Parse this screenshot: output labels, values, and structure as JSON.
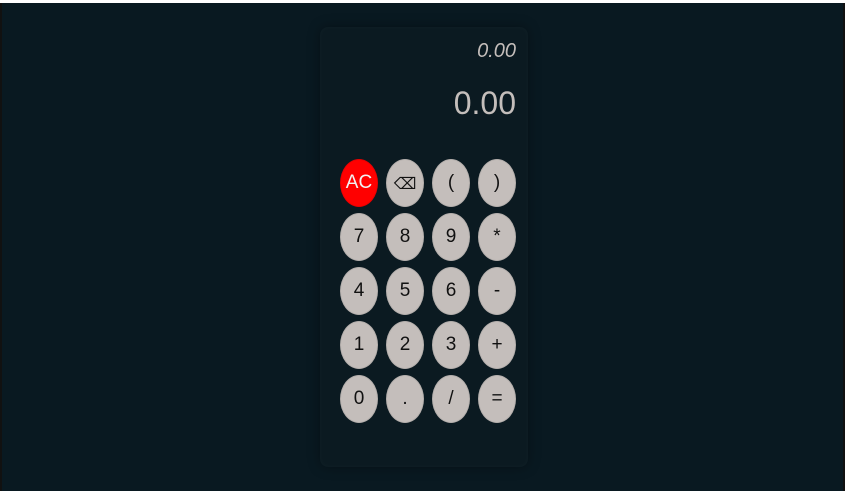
{
  "display": {
    "previous": "0.00",
    "current": "0.00"
  },
  "keys": {
    "ac": "AC",
    "backspace": "⌫",
    "paren_open": "(",
    "paren_close": ")",
    "seven": "7",
    "eight": "8",
    "nine": "9",
    "multiply": "*",
    "four": "4",
    "five": "5",
    "six": "6",
    "subtract": "-",
    "one": "1",
    "two": "2",
    "three": "3",
    "add": "+",
    "zero": "0",
    "decimal": ".",
    "divide": "/",
    "equals": "="
  },
  "colors": {
    "page_background": "#091921",
    "calculator_background": "#0b1a21",
    "key_background": "#c4bebb",
    "clear_key_background": "#ff0000",
    "display_text": "#c4bebb"
  }
}
